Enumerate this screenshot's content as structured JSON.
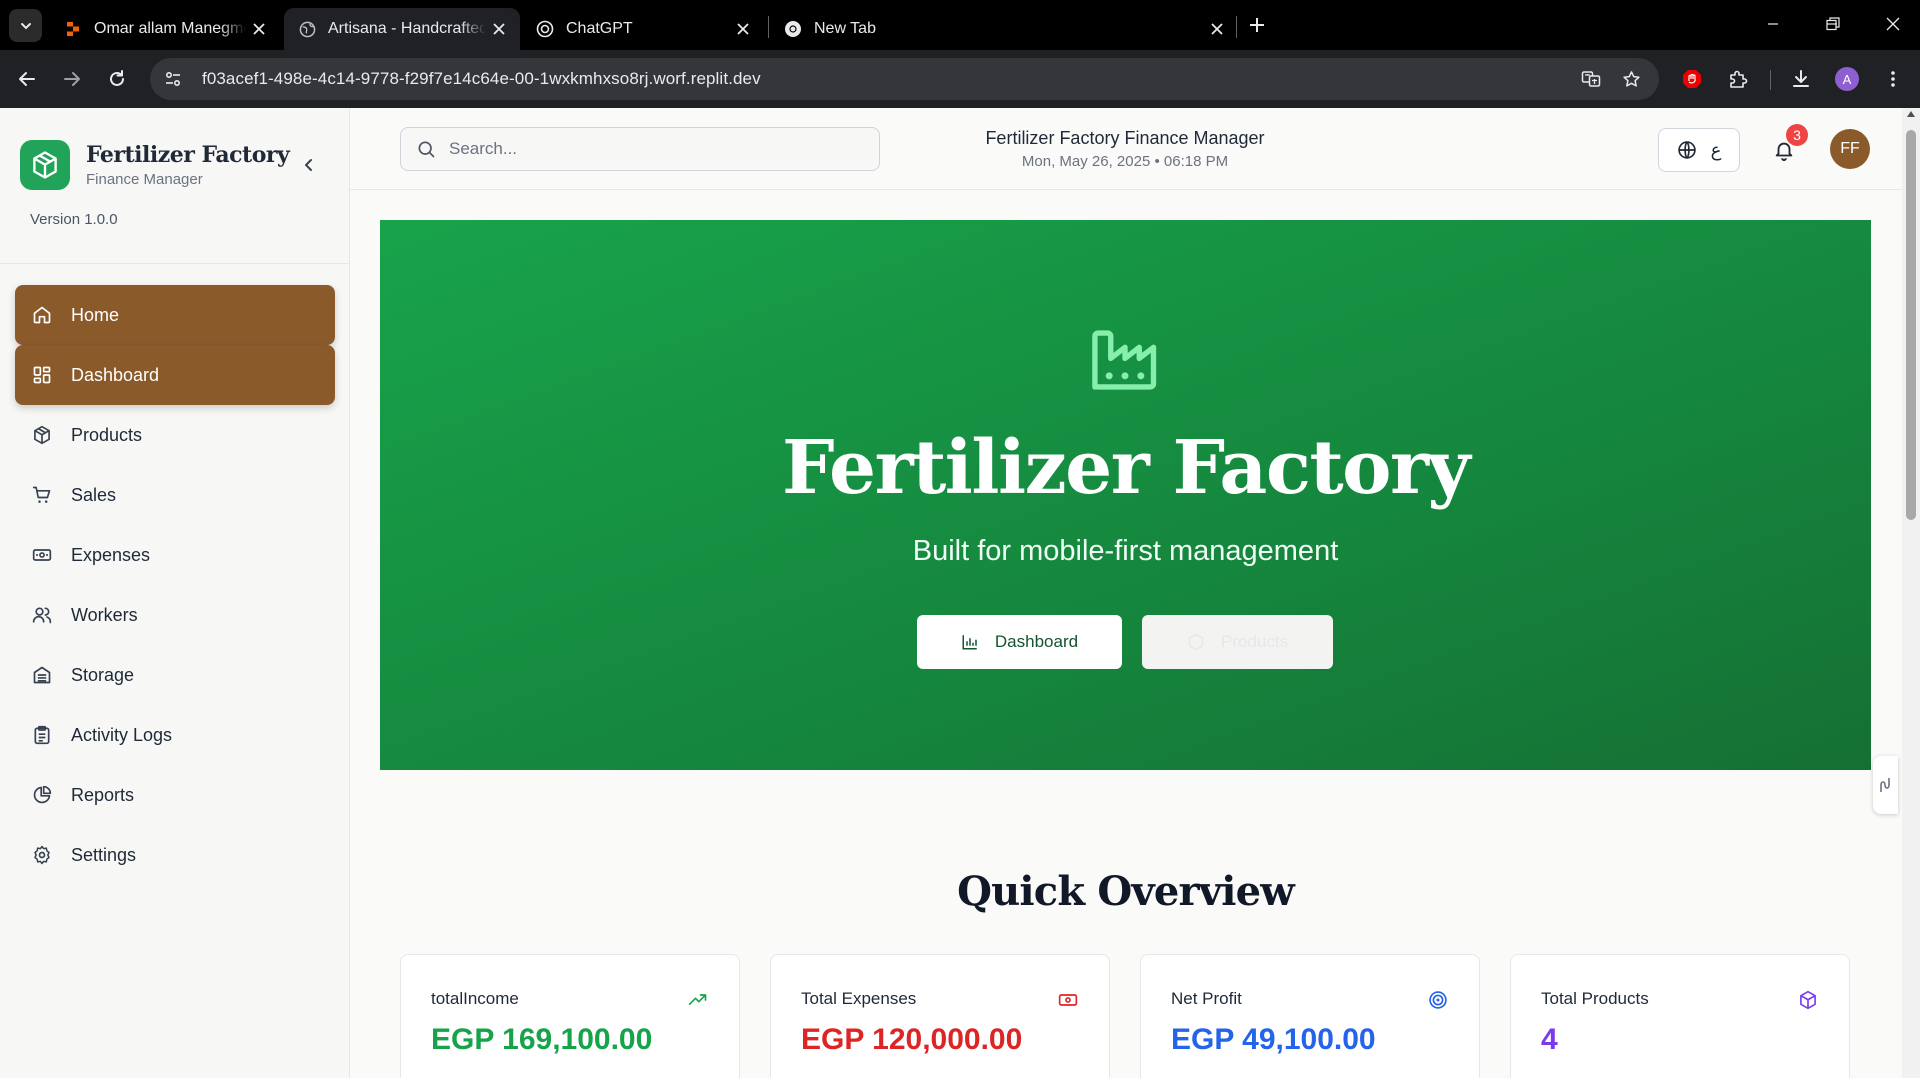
{
  "browser": {
    "tabs": [
      {
        "title": "Omar allam Manegment app - Replit",
        "favicon": "replit-icon"
      },
      {
        "title": "Artisana - Handcrafted Products",
        "favicon": "globe-icon"
      },
      {
        "title": "ChatGPT",
        "favicon": "chatgpt-icon"
      },
      {
        "title": "New Tab",
        "favicon": "chrome-icon"
      }
    ],
    "url": "f03acef1-498e-4c14-9778-f29f7e14c64e-00-1wxkmhxso8rj.worf.replit.dev",
    "profile_initial": "A"
  },
  "sidebar": {
    "brand_name": "Fertilizer Factory",
    "brand_sub": "Finance Manager",
    "version": "Version 1.0.0",
    "items": [
      {
        "label": "Home",
        "icon": "home-icon",
        "active": true
      },
      {
        "label": "Dashboard",
        "icon": "dashboard-icon",
        "active": true
      },
      {
        "label": "Products",
        "icon": "box-icon",
        "active": false
      },
      {
        "label": "Sales",
        "icon": "cart-icon",
        "active": false
      },
      {
        "label": "Expenses",
        "icon": "banknote-icon",
        "active": false
      },
      {
        "label": "Workers",
        "icon": "users-icon",
        "active": false
      },
      {
        "label": "Storage",
        "icon": "storage-icon",
        "active": false
      },
      {
        "label": "Activity Logs",
        "icon": "clipboard-icon",
        "active": false
      },
      {
        "label": "Reports",
        "icon": "pie-chart-icon",
        "active": false
      },
      {
        "label": "Settings",
        "icon": "gear-icon",
        "active": false
      }
    ]
  },
  "header": {
    "search_placeholder": "Search...",
    "title": "Fertilizer Factory Finance Manager",
    "datetime": "Mon, May 26, 2025 • 06:18 PM",
    "lang_label": "ع",
    "notification_count": "3",
    "avatar_initials": "FF"
  },
  "hero": {
    "title": "Fertilizer Factory",
    "subtitle": "Built for mobile-first management",
    "dashboard_button": "Dashboard",
    "products_button": "Products"
  },
  "overview": {
    "title": "Quick Overview",
    "cards": [
      {
        "label": "totalIncome",
        "value": "EGP 169,100.00",
        "color": "#16a34a",
        "icon": "trending-up-icon"
      },
      {
        "label": "Total Expenses",
        "value": "EGP 120,000.00",
        "color": "#dc2626",
        "icon": "banknote-icon"
      },
      {
        "label": "Net Profit",
        "value": "EGP 49,100.00",
        "color": "#2563eb",
        "icon": "target-icon"
      },
      {
        "label": "Total Products",
        "value": "4",
        "color": "#7c3aed",
        "icon": "box-icon"
      }
    ]
  },
  "colors": {
    "accent_brown": "#8a5a2b",
    "hero_green": "#18a34b",
    "brand_green": "#22a35a"
  }
}
